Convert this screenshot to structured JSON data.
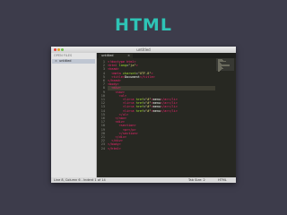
{
  "slide_title": "HTML",
  "window": {
    "title": "untitled"
  },
  "sidebar": {
    "heading": "OPEN FILES",
    "files": [
      {
        "close": "×",
        "name": "untitled"
      }
    ]
  },
  "tabs": [
    {
      "label": "untitled",
      "close": "×"
    }
  ],
  "editor": {
    "line_numbers": [
      "1",
      "2",
      "3",
      "4",
      "5",
      "6",
      "7",
      "8",
      "9",
      "10",
      "11",
      "12",
      "13",
      "14",
      "15",
      "16",
      "17",
      "18",
      "19",
      "20",
      "21",
      "22",
      "23",
      "24"
    ],
    "lines": [
      [
        {
          "c": "tag",
          "t": "<!doctype html>"
        }
      ],
      [
        {
          "c": "tag",
          "t": "<html "
        },
        {
          "c": "attr",
          "t": "lang"
        },
        {
          "c": "txt",
          "t": "="
        },
        {
          "c": "str",
          "t": "\"ja\""
        },
        {
          "c": "tag",
          "t": ">"
        }
      ],
      [
        {
          "c": "tag",
          "t": "<head>"
        }
      ],
      [
        {
          "c": "txt",
          "t": "  "
        },
        {
          "c": "tag",
          "t": "<meta "
        },
        {
          "c": "attr",
          "t": "charset"
        },
        {
          "c": "txt",
          "t": "="
        },
        {
          "c": "str",
          "t": "\"UTF-8\""
        },
        {
          "c": "tag",
          "t": ">"
        }
      ],
      [
        {
          "c": "txt",
          "t": "  "
        },
        {
          "c": "tag",
          "t": "<title>"
        },
        {
          "c": "txt",
          "t": "Document"
        },
        {
          "c": "tag",
          "t": "</title>"
        }
      ],
      [
        {
          "c": "tag",
          "t": "</head>"
        }
      ],
      [
        {
          "c": "tag",
          "t": "<body>"
        }
      ],
      [
        {
          "c": "txt",
          "t": "  "
        },
        {
          "c": "tag",
          "t": "<div>"
        }
      ],
      [
        {
          "c": "txt",
          "t": "    "
        },
        {
          "c": "tag",
          "t": "<nav>"
        }
      ],
      [
        {
          "c": "txt",
          "t": "      "
        },
        {
          "c": "tag",
          "t": "<ul>"
        }
      ],
      [
        {
          "c": "txt",
          "t": "        "
        },
        {
          "c": "tag",
          "t": "<li>"
        },
        {
          "c": "tag",
          "t": "<a "
        },
        {
          "c": "attr",
          "t": "href"
        },
        {
          "c": "txt",
          "t": "="
        },
        {
          "c": "str",
          "t": "\"#\""
        },
        {
          "c": "tag",
          "t": ">"
        },
        {
          "c": "txt",
          "t": "menu"
        },
        {
          "c": "tag",
          "t": "</a></li>"
        }
      ],
      [
        {
          "c": "txt",
          "t": "        "
        },
        {
          "c": "tag",
          "t": "<li>"
        },
        {
          "c": "tag",
          "t": "<a "
        },
        {
          "c": "attr",
          "t": "href"
        },
        {
          "c": "txt",
          "t": "="
        },
        {
          "c": "str",
          "t": "\"#\""
        },
        {
          "c": "tag",
          "t": ">"
        },
        {
          "c": "txt",
          "t": "menu"
        },
        {
          "c": "tag",
          "t": "</a></li>"
        }
      ],
      [
        {
          "c": "txt",
          "t": "        "
        },
        {
          "c": "tag",
          "t": "<li>"
        },
        {
          "c": "tag",
          "t": "<a "
        },
        {
          "c": "attr",
          "t": "href"
        },
        {
          "c": "txt",
          "t": "="
        },
        {
          "c": "str",
          "t": "\"#\""
        },
        {
          "c": "tag",
          "t": ">"
        },
        {
          "c": "txt",
          "t": "menu"
        },
        {
          "c": "tag",
          "t": "</a></li>"
        }
      ],
      [
        {
          "c": "txt",
          "t": "        "
        },
        {
          "c": "tag",
          "t": "<li>"
        },
        {
          "c": "tag",
          "t": "<a "
        },
        {
          "c": "attr",
          "t": "href"
        },
        {
          "c": "txt",
          "t": "="
        },
        {
          "c": "str",
          "t": "\"#\""
        },
        {
          "c": "tag",
          "t": ">"
        },
        {
          "c": "txt",
          "t": "menu"
        },
        {
          "c": "tag",
          "t": "</a></li>"
        }
      ],
      [
        {
          "c": "txt",
          "t": "      "
        },
        {
          "c": "tag",
          "t": "</ul>"
        }
      ],
      [
        {
          "c": "txt",
          "t": "    "
        },
        {
          "c": "tag",
          "t": "</nav>"
        }
      ],
      [
        {
          "c": "txt",
          "t": "    "
        },
        {
          "c": "tag",
          "t": "<div>"
        }
      ],
      [
        {
          "c": "txt",
          "t": "      "
        },
        {
          "c": "tag",
          "t": "<section>"
        }
      ],
      [
        {
          "c": "txt",
          "t": "        "
        },
        {
          "c": "tag",
          "t": "<p></p>"
        }
      ],
      [
        {
          "c": "txt",
          "t": "      "
        },
        {
          "c": "tag",
          "t": "</section>"
        }
      ],
      [
        {
          "c": "txt",
          "t": "    "
        },
        {
          "c": "tag",
          "t": "</div>"
        }
      ],
      [
        {
          "c": "txt",
          "t": "  "
        },
        {
          "c": "tag",
          "t": "</div>"
        }
      ],
      [
        {
          "c": "tag",
          "t": "</body>"
        }
      ],
      [
        {
          "c": "tag",
          "t": "</html>"
        }
      ]
    ],
    "highlighted_line": 7
  },
  "status": {
    "position": "Line 8, Column 6 - Indent 1 of 14",
    "tab_size": "Tab Size: 2",
    "syntax": "HTML"
  }
}
